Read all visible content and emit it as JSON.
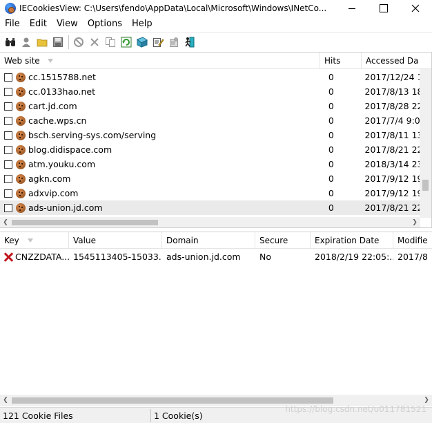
{
  "window": {
    "title": "IECookiesView:  C:\\Users\\fendo\\AppData\\Local\\Microsoft\\Windows\\INetCo..."
  },
  "menu": [
    "File",
    "Edit",
    "View",
    "Options",
    "Help"
  ],
  "toolbar": {
    "icons": [
      "find-icon",
      "user-icon",
      "folder-icon",
      "save-icon",
      "block-icon",
      "delete-icon",
      "copy-icon",
      "refresh-icon",
      "open-cookie-icon",
      "edit-icon",
      "properties-icon",
      "exit-icon"
    ]
  },
  "cookie_list": {
    "columns": [
      "Web site",
      "Hits",
      "Accessed Da"
    ],
    "rows": [
      {
        "site": "cc.1515788.net",
        "hits": "0",
        "accessed": "2017/12/24 1"
      },
      {
        "site": "cc.0133hao.net",
        "hits": "0",
        "accessed": "2017/8/13 18"
      },
      {
        "site": "cart.jd.com",
        "hits": "0",
        "accessed": "2017/8/28 22"
      },
      {
        "site": "cache.wps.cn",
        "hits": "0",
        "accessed": "2017/7/4 9:0"
      },
      {
        "site": "bsch.serving-sys.com/serving",
        "hits": "0",
        "accessed": "2017/8/11 13"
      },
      {
        "site": "blog.didispace.com",
        "hits": "0",
        "accessed": "2017/8/21 22"
      },
      {
        "site": "atm.youku.com",
        "hits": "0",
        "accessed": "2018/3/14 23"
      },
      {
        "site": "agkn.com",
        "hits": "0",
        "accessed": "2017/9/12 19"
      },
      {
        "site": "adxvip.com",
        "hits": "0",
        "accessed": "2017/9/12 19"
      },
      {
        "site": "ads-union.jd.com",
        "hits": "0",
        "accessed": "2017/8/21 22"
      }
    ]
  },
  "details": {
    "columns": [
      "Key",
      "Value",
      "Domain",
      "Secure",
      "Expiration Date",
      "Modifie"
    ],
    "rows": [
      {
        "key": "CNZZDATA...",
        "value": "1545113405-15033...",
        "domain": "ads-union.jd.com",
        "secure": "No",
        "expiration": "2018/2/19 22:05:...",
        "modified": "2017/8/"
      }
    ]
  },
  "status": {
    "count": "121 Cookie Files",
    "selected": "1 Cookie(s)"
  },
  "watermark": "https://blog.csdn.net/u011781521"
}
